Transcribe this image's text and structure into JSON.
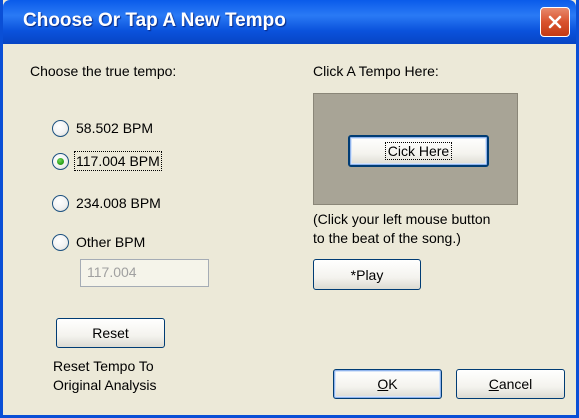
{
  "window": {
    "title": "Choose Or Tap A New Tempo",
    "close_icon": "close-x-icon",
    "title_bar_color": "#0a52dc",
    "close_button_color": "#d9532e"
  },
  "tempo_choice": {
    "heading": "Choose the true tempo:",
    "options": [
      {
        "label": "58.502 BPM",
        "selected": false
      },
      {
        "label": "117.004 BPM",
        "selected": true
      },
      {
        "label": "234.008 BPM",
        "selected": false
      },
      {
        "label": "Other BPM",
        "selected": false
      }
    ],
    "other_value": "117.004"
  },
  "reset": {
    "button_label": "Reset",
    "caption_line1": "Reset Tempo To",
    "caption_line2": "Original Analysis"
  },
  "tap": {
    "heading": "Click A Tempo Here:",
    "button_label": "Cick Here",
    "hint_line1": "(Click your left mouse button",
    "hint_line2": "to the beat of the song.)",
    "play_label": "*Play",
    "panel_color": "#a8a496"
  },
  "footer": {
    "ok_prefix": "",
    "ok_underlined": "O",
    "ok_rest": "K",
    "cancel_underlined": "C",
    "cancel_rest": "ancel"
  }
}
